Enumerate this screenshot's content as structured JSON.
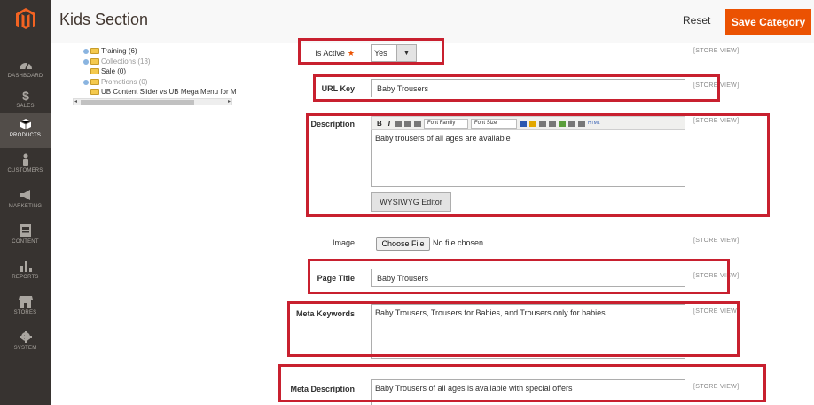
{
  "header": {
    "title": "Kids Section",
    "reset_label": "Reset",
    "save_label": "Save Category"
  },
  "sidebar": {
    "items": [
      {
        "label": "DASHBOARD",
        "icon": "dashboard-icon"
      },
      {
        "label": "SALES",
        "icon": "dollar-icon"
      },
      {
        "label": "PRODUCTS",
        "icon": "box-icon",
        "active": true
      },
      {
        "label": "CUSTOMERS",
        "icon": "person-icon"
      },
      {
        "label": "MARKETING",
        "icon": "megaphone-icon"
      },
      {
        "label": "CONTENT",
        "icon": "content-icon"
      },
      {
        "label": "REPORTS",
        "icon": "bar-chart-icon"
      },
      {
        "label": "STORES",
        "icon": "store-icon"
      },
      {
        "label": "SYSTEM",
        "icon": "gear-icon"
      }
    ]
  },
  "tree": {
    "items": [
      {
        "label": "Training (6)",
        "muted": false
      },
      {
        "label": "Collections (13)",
        "muted": true
      },
      {
        "label": "Sale (0)",
        "muted": false
      },
      {
        "label": "Promotions (0)",
        "muted": true
      },
      {
        "label": "UB Content Slider vs UB Mega Menu for M",
        "muted": false
      }
    ]
  },
  "form": {
    "is_active": {
      "label": "Is Active",
      "required": "★",
      "value": "Yes",
      "scope": "[STORE VIEW]"
    },
    "url_key": {
      "label": "URL Key",
      "value": "Baby Trousers",
      "scope": "[STORE VIEW]"
    },
    "description": {
      "label": "Description",
      "value": "Baby trousers of all ages are available",
      "scope": "[STORE VIEW]",
      "toolbar": {
        "bold": "B",
        "italic": "I",
        "font_family": "Font Family",
        "font_size": "Font Size",
        "html": "HTML"
      },
      "wysiwyg_label": "WYSIWYG Editor"
    },
    "image": {
      "label": "Image",
      "button": "Choose File",
      "status": "No file chosen",
      "scope": "[STORE VIEW]"
    },
    "page_title": {
      "label": "Page Title",
      "value": "Baby Trousers",
      "scope": "[STORE VIEW]"
    },
    "meta_keywords": {
      "label": "Meta Keywords",
      "value": "Baby Trousers, Trousers for Babies, and Trousers only for babies",
      "scope": "[STORE VIEW]"
    },
    "meta_description": {
      "label": "Meta Description",
      "value": "Baby Trousers of all ages is available with special offers",
      "scope": "[STORE VIEW]"
    }
  },
  "colors": {
    "sidebar": "#373330",
    "accent": "#eb5202",
    "highlight": "#c8202f"
  }
}
